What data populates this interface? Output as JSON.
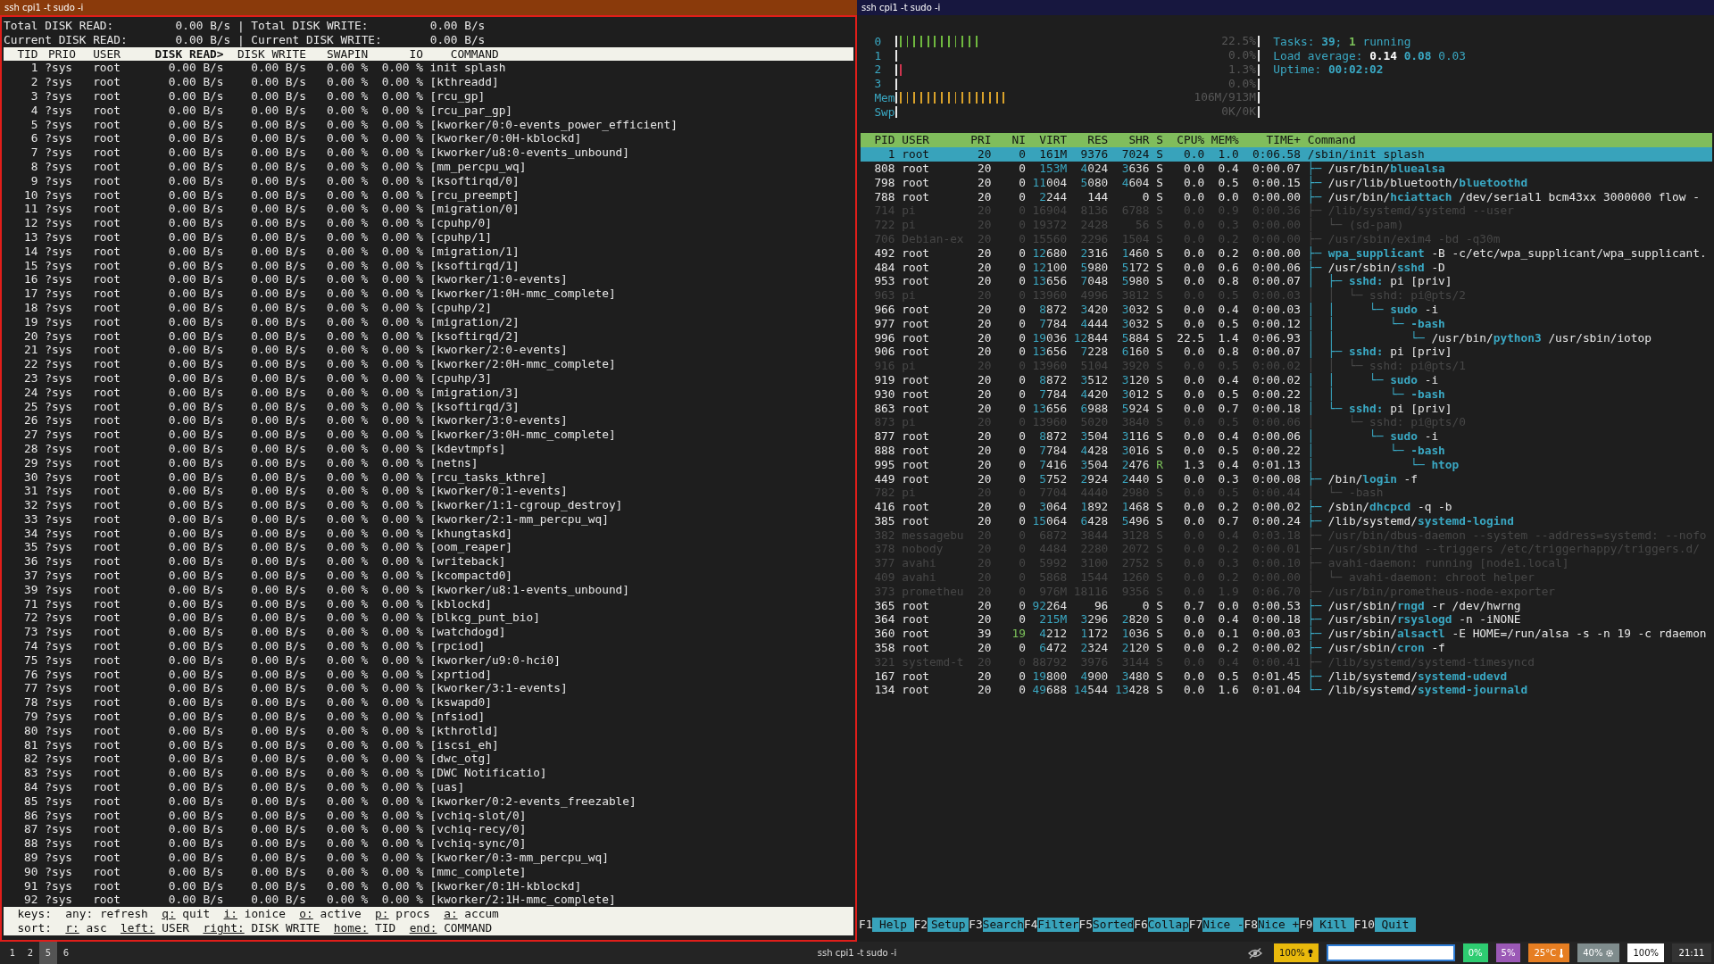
{
  "left_window": {
    "title": "ssh cpi1 -t sudo -i",
    "active": true,
    "summary": [
      "Total DISK READ:         0.00 B/s | Total DISK WRITE:         0.00 B/s",
      "Current DISK READ:       0.00 B/s | Current DISK WRITE:       0.00 B/s"
    ],
    "columns": [
      {
        "label": "TID",
        "sorted": false
      },
      {
        "label": "PRIO",
        "sorted": false
      },
      {
        "label": "USER",
        "sorted": false
      },
      {
        "label": "DISK READ>",
        "sorted": true
      },
      {
        "label": "DISK WRITE",
        "sorted": false
      },
      {
        "label": "SWAPIN",
        "sorted": false
      },
      {
        "label": "IO",
        "sorted": false
      },
      {
        "label": "COMMAND",
        "sorted": false
      }
    ],
    "rows": [
      [
        "1",
        "?sys",
        "root",
        "0.00 B/s",
        "0.00 B/s",
        "0.00 %",
        "0.00 %",
        "init splash"
      ],
      [
        "2",
        "?sys",
        "root",
        "0.00 B/s",
        "0.00 B/s",
        "0.00 %",
        "0.00 %",
        "[kthreadd]"
      ],
      [
        "3",
        "?sys",
        "root",
        "0.00 B/s",
        "0.00 B/s",
        "0.00 %",
        "0.00 %",
        "[rcu_gp]"
      ],
      [
        "4",
        "?sys",
        "root",
        "0.00 B/s",
        "0.00 B/s",
        "0.00 %",
        "0.00 %",
        "[rcu_par_gp]"
      ],
      [
        "5",
        "?sys",
        "root",
        "0.00 B/s",
        "0.00 B/s",
        "0.00 %",
        "0.00 %",
        "[kworker/0:0-events_power_efficient]"
      ],
      [
        "6",
        "?sys",
        "root",
        "0.00 B/s",
        "0.00 B/s",
        "0.00 %",
        "0.00 %",
        "[kworker/0:0H-kblockd]"
      ],
      [
        "7",
        "?sys",
        "root",
        "0.00 B/s",
        "0.00 B/s",
        "0.00 %",
        "0.00 %",
        "[kworker/u8:0-events_unbound]"
      ],
      [
        "8",
        "?sys",
        "root",
        "0.00 B/s",
        "0.00 B/s",
        "0.00 %",
        "0.00 %",
        "[mm_percpu_wq]"
      ],
      [
        "9",
        "?sys",
        "root",
        "0.00 B/s",
        "0.00 B/s",
        "0.00 %",
        "0.00 %",
        "[ksoftirqd/0]"
      ],
      [
        "10",
        "?sys",
        "root",
        "0.00 B/s",
        "0.00 B/s",
        "0.00 %",
        "0.00 %",
        "[rcu_preempt]"
      ],
      [
        "11",
        "?sys",
        "root",
        "0.00 B/s",
        "0.00 B/s",
        "0.00 %",
        "0.00 %",
        "[migration/0]"
      ],
      [
        "12",
        "?sys",
        "root",
        "0.00 B/s",
        "0.00 B/s",
        "0.00 %",
        "0.00 %",
        "[cpuhp/0]"
      ],
      [
        "13",
        "?sys",
        "root",
        "0.00 B/s",
        "0.00 B/s",
        "0.00 %",
        "0.00 %",
        "[cpuhp/1]"
      ],
      [
        "14",
        "?sys",
        "root",
        "0.00 B/s",
        "0.00 B/s",
        "0.00 %",
        "0.00 %",
        "[migration/1]"
      ],
      [
        "15",
        "?sys",
        "root",
        "0.00 B/s",
        "0.00 B/s",
        "0.00 %",
        "0.00 %",
        "[ksoftirqd/1]"
      ],
      [
        "16",
        "?sys",
        "root",
        "0.00 B/s",
        "0.00 B/s",
        "0.00 %",
        "0.00 %",
        "[kworker/1:0-events]"
      ],
      [
        "17",
        "?sys",
        "root",
        "0.00 B/s",
        "0.00 B/s",
        "0.00 %",
        "0.00 %",
        "[kworker/1:0H-mmc_complete]"
      ],
      [
        "18",
        "?sys",
        "root",
        "0.00 B/s",
        "0.00 B/s",
        "0.00 %",
        "0.00 %",
        "[cpuhp/2]"
      ],
      [
        "19",
        "?sys",
        "root",
        "0.00 B/s",
        "0.00 B/s",
        "0.00 %",
        "0.00 %",
        "[migration/2]"
      ],
      [
        "20",
        "?sys",
        "root",
        "0.00 B/s",
        "0.00 B/s",
        "0.00 %",
        "0.00 %",
        "[ksoftirqd/2]"
      ],
      [
        "21",
        "?sys",
        "root",
        "0.00 B/s",
        "0.00 B/s",
        "0.00 %",
        "0.00 %",
        "[kworker/2:0-events]"
      ],
      [
        "22",
        "?sys",
        "root",
        "0.00 B/s",
        "0.00 B/s",
        "0.00 %",
        "0.00 %",
        "[kworker/2:0H-mmc_complete]"
      ],
      [
        "23",
        "?sys",
        "root",
        "0.00 B/s",
        "0.00 B/s",
        "0.00 %",
        "0.00 %",
        "[cpuhp/3]"
      ],
      [
        "24",
        "?sys",
        "root",
        "0.00 B/s",
        "0.00 B/s",
        "0.00 %",
        "0.00 %",
        "[migration/3]"
      ],
      [
        "25",
        "?sys",
        "root",
        "0.00 B/s",
        "0.00 B/s",
        "0.00 %",
        "0.00 %",
        "[ksoftirqd/3]"
      ],
      [
        "26",
        "?sys",
        "root",
        "0.00 B/s",
        "0.00 B/s",
        "0.00 %",
        "0.00 %",
        "[kworker/3:0-events]"
      ],
      [
        "27",
        "?sys",
        "root",
        "0.00 B/s",
        "0.00 B/s",
        "0.00 %",
        "0.00 %",
        "[kworker/3:0H-mmc_complete]"
      ],
      [
        "28",
        "?sys",
        "root",
        "0.00 B/s",
        "0.00 B/s",
        "0.00 %",
        "0.00 %",
        "[kdevtmpfs]"
      ],
      [
        "29",
        "?sys",
        "root",
        "0.00 B/s",
        "0.00 B/s",
        "0.00 %",
        "0.00 %",
        "[netns]"
      ],
      [
        "30",
        "?sys",
        "root",
        "0.00 B/s",
        "0.00 B/s",
        "0.00 %",
        "0.00 %",
        "[rcu_tasks_kthre]"
      ],
      [
        "31",
        "?sys",
        "root",
        "0.00 B/s",
        "0.00 B/s",
        "0.00 %",
        "0.00 %",
        "[kworker/0:1-events]"
      ],
      [
        "32",
        "?sys",
        "root",
        "0.00 B/s",
        "0.00 B/s",
        "0.00 %",
        "0.00 %",
        "[kworker/1:1-cgroup_destroy]"
      ],
      [
        "33",
        "?sys",
        "root",
        "0.00 B/s",
        "0.00 B/s",
        "0.00 %",
        "0.00 %",
        "[kworker/2:1-mm_percpu_wq]"
      ],
      [
        "34",
        "?sys",
        "root",
        "0.00 B/s",
        "0.00 B/s",
        "0.00 %",
        "0.00 %",
        "[khungtaskd]"
      ],
      [
        "35",
        "?sys",
        "root",
        "0.00 B/s",
        "0.00 B/s",
        "0.00 %",
        "0.00 %",
        "[oom_reaper]"
      ],
      [
        "36",
        "?sys",
        "root",
        "0.00 B/s",
        "0.00 B/s",
        "0.00 %",
        "0.00 %",
        "[writeback]"
      ],
      [
        "37",
        "?sys",
        "root",
        "0.00 B/s",
        "0.00 B/s",
        "0.00 %",
        "0.00 %",
        "[kcompactd0]"
      ],
      [
        "39",
        "?sys",
        "root",
        "0.00 B/s",
        "0.00 B/s",
        "0.00 %",
        "0.00 %",
        "[kworker/u8:1-events_unbound]"
      ],
      [
        "71",
        "?sys",
        "root",
        "0.00 B/s",
        "0.00 B/s",
        "0.00 %",
        "0.00 %",
        "[kblockd]"
      ],
      [
        "72",
        "?sys",
        "root",
        "0.00 B/s",
        "0.00 B/s",
        "0.00 %",
        "0.00 %",
        "[blkcg_punt_bio]"
      ],
      [
        "73",
        "?sys",
        "root",
        "0.00 B/s",
        "0.00 B/s",
        "0.00 %",
        "0.00 %",
        "[watchdogd]"
      ],
      [
        "74",
        "?sys",
        "root",
        "0.00 B/s",
        "0.00 B/s",
        "0.00 %",
        "0.00 %",
        "[rpciod]"
      ],
      [
        "75",
        "?sys",
        "root",
        "0.00 B/s",
        "0.00 B/s",
        "0.00 %",
        "0.00 %",
        "[kworker/u9:0-hci0]"
      ],
      [
        "76",
        "?sys",
        "root",
        "0.00 B/s",
        "0.00 B/s",
        "0.00 %",
        "0.00 %",
        "[xprtiod]"
      ],
      [
        "77",
        "?sys",
        "root",
        "0.00 B/s",
        "0.00 B/s",
        "0.00 %",
        "0.00 %",
        "[kworker/3:1-events]"
      ],
      [
        "78",
        "?sys",
        "root",
        "0.00 B/s",
        "0.00 B/s",
        "0.00 %",
        "0.00 %",
        "[kswapd0]"
      ],
      [
        "79",
        "?sys",
        "root",
        "0.00 B/s",
        "0.00 B/s",
        "0.00 %",
        "0.00 %",
        "[nfsiod]"
      ],
      [
        "80",
        "?sys",
        "root",
        "0.00 B/s",
        "0.00 B/s",
        "0.00 %",
        "0.00 %",
        "[kthrotld]"
      ],
      [
        "81",
        "?sys",
        "root",
        "0.00 B/s",
        "0.00 B/s",
        "0.00 %",
        "0.00 %",
        "[iscsi_eh]"
      ],
      [
        "82",
        "?sys",
        "root",
        "0.00 B/s",
        "0.00 B/s",
        "0.00 %",
        "0.00 %",
        "[dwc_otg]"
      ],
      [
        "83",
        "?sys",
        "root",
        "0.00 B/s",
        "0.00 B/s",
        "0.00 %",
        "0.00 %",
        "[DWC Notificatio]"
      ],
      [
        "84",
        "?sys",
        "root",
        "0.00 B/s",
        "0.00 B/s",
        "0.00 %",
        "0.00 %",
        "[uas]"
      ],
      [
        "85",
        "?sys",
        "root",
        "0.00 B/s",
        "0.00 B/s",
        "0.00 %",
        "0.00 %",
        "[kworker/0:2-events_freezable]"
      ],
      [
        "86",
        "?sys",
        "root",
        "0.00 B/s",
        "0.00 B/s",
        "0.00 %",
        "0.00 %",
        "[vchiq-slot/0]"
      ],
      [
        "87",
        "?sys",
        "root",
        "0.00 B/s",
        "0.00 B/s",
        "0.00 %",
        "0.00 %",
        "[vchiq-recy/0]"
      ],
      [
        "88",
        "?sys",
        "root",
        "0.00 B/s",
        "0.00 B/s",
        "0.00 %",
        "0.00 %",
        "[vchiq-sync/0]"
      ],
      [
        "89",
        "?sys",
        "root",
        "0.00 B/s",
        "0.00 B/s",
        "0.00 %",
        "0.00 %",
        "[kworker/0:3-mm_percpu_wq]"
      ],
      [
        "90",
        "?sys",
        "root",
        "0.00 B/s",
        "0.00 B/s",
        "0.00 %",
        "0.00 %",
        "[mmc_complete]"
      ],
      [
        "91",
        "?sys",
        "root",
        "0.00 B/s",
        "0.00 B/s",
        "0.00 %",
        "0.00 %",
        "[kworker/0:1H-kblockd]"
      ],
      [
        "92",
        "?sys",
        "root",
        "0.00 B/s",
        "0.00 B/s",
        "0.00 %",
        "0.00 %",
        "[kworker/2:1H-mmc_complete]"
      ]
    ],
    "key_lines": [
      {
        "prefix": "keys:",
        "items": [
          {
            "key": "any:",
            "action": "refresh",
            "underlined": false
          },
          {
            "key": "q:",
            "action": "quit",
            "underlined": true
          },
          {
            "key": "i:",
            "action": "ionice",
            "underlined": true
          },
          {
            "key": "o:",
            "action": "active",
            "underlined": true
          },
          {
            "key": "p:",
            "action": "procs",
            "underlined": true
          },
          {
            "key": "a:",
            "action": "accum",
            "underlined": true
          }
        ]
      },
      {
        "prefix": "sort:",
        "items": [
          {
            "key": "r:",
            "action": "asc",
            "underlined": true
          },
          {
            "key": "left:",
            "action": "USER",
            "underlined": true
          },
          {
            "key": "right:",
            "action": "DISK WRITE",
            "underlined": true
          },
          {
            "key": "home:",
            "action": "TID",
            "underlined": true
          },
          {
            "key": "end:",
            "action": "COMMAND",
            "underlined": true
          }
        ]
      }
    ]
  },
  "right_window": {
    "title": "ssh cpi1 -t sudo -i",
    "active": false,
    "meters": [
      {
        "label": "0",
        "reading": "22.5%",
        "level": 0.227,
        "color": "#6fb83f"
      },
      {
        "label": "1",
        "reading": "0.0%"
      },
      {
        "label": "2",
        "reading": "1.3%",
        "level": 0.019,
        "color": "#d0354f"
      },
      {
        "label": "3",
        "reading": "0.0%"
      },
      {
        "label": "Mem",
        "reading": "106M/913M",
        "level": 0.302,
        "color": "#d8a12a"
      },
      {
        "label": "Swp",
        "reading": "0K/0K"
      }
    ],
    "tasks": {
      "label": "Tasks:",
      "count": "39",
      "separator": ";",
      "running": "1",
      "running_label": "running"
    },
    "load": {
      "label": "Load average:",
      "values": [
        "0.14",
        "0.08",
        "0.03"
      ]
    },
    "uptime": {
      "label": "Uptime:",
      "value": "00:02:02"
    },
    "columns": [
      "PID",
      "USER",
      "PRI",
      "NI",
      "VIRT",
      "RES",
      "SHR",
      "S",
      "CPU%",
      "MEM%",
      "TIME+",
      "Command"
    ],
    "rows": [
      {
        "pid": "1",
        "user": "root",
        "pri": "20",
        "ni": "0",
        "virt": "161M",
        "res": "9376",
        "shr": "7024",
        "s": "S",
        "cpu": "0.0",
        "mem": "1.0",
        "time": "0:06.58",
        "command": "/sbin/init splash",
        "selected": true,
        "dimmed": false,
        "running": false,
        "niced": false
      },
      {
        "pid": "808",
        "user": "root",
        "pri": "20",
        "ni": "0",
        "virt": "153M",
        "res": "4024",
        "shr": "3636",
        "s": "S",
        "cpu": "0.0",
        "mem": "0.4",
        "time": "0:00.07",
        "tree": "├─ ",
        "command": "/usr/bin/**bluealsa**",
        "selected": false,
        "dimmed": false,
        "running": false,
        "niced": false
      },
      {
        "pid": "798",
        "user": "root",
        "pri": "20",
        "ni": "0",
        "virt": "11004",
        "res": "5080",
        "shr": "4604",
        "s": "S",
        "cpu": "0.0",
        "mem": "0.5",
        "time": "0:00.15",
        "tree": "├─ ",
        "command": "/usr/lib/bluetooth/**bluetoothd**",
        "selected": false,
        "dimmed": false,
        "running": false,
        "niced": false
      },
      {
        "pid": "788",
        "user": "root",
        "pri": "20",
        "ni": "0",
        "virt": "2244",
        "res": "144",
        "shr": "0",
        "s": "S",
        "cpu": "0.0",
        "mem": "0.0",
        "time": "0:00.00",
        "tree": "├─ ",
        "command": "/usr/bin/**hciattach** /dev/serial1 bcm43xx 3000000 flow -",
        "selected": false,
        "dimmed": false,
        "running": false,
        "niced": false
      },
      {
        "pid": "714",
        "user": "pi",
        "pri": "20",
        "ni": "0",
        "virt": "16904",
        "res": "8136",
        "shr": "6788",
        "s": "S",
        "cpu": "0.0",
        "mem": "0.9",
        "time": "0:00.36",
        "tree": "├─ ",
        "command": "/lib/systemd/systemd --user",
        "selected": false,
        "dimmed": true,
        "running": false,
        "niced": false
      },
      {
        "pid": "722",
        "user": "pi",
        "pri": "20",
        "ni": "0",
        "virt": "19372",
        "res": "2428",
        "shr": "56",
        "s": "S",
        "cpu": "0.0",
        "mem": "0.3",
        "time": "0:00.00",
        "tree": "│  └─ ",
        "command": "(sd-pam)",
        "selected": false,
        "dimmed": true,
        "running": false,
        "niced": false
      },
      {
        "pid": "706",
        "user": "Debian-ex",
        "pri": "20",
        "ni": "0",
        "virt": "15560",
        "res": "2296",
        "shr": "1504",
        "s": "S",
        "cpu": "0.0",
        "mem": "0.2",
        "time": "0:00.00",
        "tree": "├─ ",
        "command": "/usr/sbin/exim4 -bd -q30m",
        "selected": false,
        "dimmed": true,
        "running": false,
        "niced": false
      },
      {
        "pid": "492",
        "user": "root",
        "pri": "20",
        "ni": "0",
        "virt": "12680",
        "res": "2316",
        "shr": "1460",
        "s": "S",
        "cpu": "0.0",
        "mem": "0.2",
        "time": "0:00.00",
        "tree": "├─ ",
        "command": "**wpa_supplicant** -B -c/etc/wpa_supplicant/wpa_supplicant.",
        "selected": false,
        "dimmed": false,
        "running": false,
        "niced": false
      },
      {
        "pid": "484",
        "user": "root",
        "pri": "20",
        "ni": "0",
        "virt": "12100",
        "res": "5980",
        "shr": "5172",
        "s": "S",
        "cpu": "0.0",
        "mem": "0.6",
        "time": "0:00.06",
        "tree": "├─ ",
        "command": "/usr/sbin/**sshd** -D",
        "selected": false,
        "dimmed": false,
        "running": false,
        "niced": false
      },
      {
        "pid": "953",
        "user": "root",
        "pri": "20",
        "ni": "0",
        "virt": "13656",
        "res": "7048",
        "shr": "5980",
        "s": "S",
        "cpu": "0.0",
        "mem": "0.8",
        "time": "0:00.07",
        "tree": "│  ├─ ",
        "command": "**sshd:** pi [priv]",
        "selected": false,
        "dimmed": false,
        "running": false,
        "niced": false
      },
      {
        "pid": "963",
        "user": "pi",
        "pri": "20",
        "ni": "0",
        "virt": "13960",
        "res": "4996",
        "shr": "3812",
        "s": "S",
        "cpu": "0.0",
        "mem": "0.5",
        "time": "0:00.03",
        "tree": "│  │  └─ ",
        "command": "sshd: pi@pts/2",
        "selected": false,
        "dimmed": true,
        "running": false,
        "niced": false
      },
      {
        "pid": "966",
        "user": "root",
        "pri": "20",
        "ni": "0",
        "virt": "8872",
        "res": "3420",
        "shr": "3032",
        "s": "S",
        "cpu": "0.0",
        "mem": "0.4",
        "time": "0:00.03",
        "tree": "│  │     └─ ",
        "command": "**sudo** -i",
        "selected": false,
        "dimmed": false,
        "running": false,
        "niced": false
      },
      {
        "pid": "977",
        "user": "root",
        "pri": "20",
        "ni": "0",
        "virt": "7784",
        "res": "4444",
        "shr": "3032",
        "s": "S",
        "cpu": "0.0",
        "mem": "0.5",
        "time": "0:00.12",
        "tree": "│  │        └─ ",
        "command": "**-bash**",
        "selected": false,
        "dimmed": false,
        "running": false,
        "niced": false
      },
      {
        "pid": "996",
        "user": "root",
        "pri": "20",
        "ni": "0",
        "virt": "19036",
        "res": "12844",
        "shr": "5884",
        "s": "S",
        "cpu": "22.5",
        "mem": "1.4",
        "time": "0:06.93",
        "tree": "│  │           └─ ",
        "command": "/usr/bin/**python3** /usr/sbin/iotop",
        "selected": false,
        "dimmed": false,
        "running": false,
        "niced": false
      },
      {
        "pid": "906",
        "user": "root",
        "pri": "20",
        "ni": "0",
        "virt": "13656",
        "res": "7228",
        "shr": "6160",
        "s": "S",
        "cpu": "0.0",
        "mem": "0.8",
        "time": "0:00.07",
        "tree": "│  ├─ ",
        "command": "**sshd:** pi [priv]",
        "selected": false,
        "dimmed": false,
        "running": false,
        "niced": false
      },
      {
        "pid": "916",
        "user": "pi",
        "pri": "20",
        "ni": "0",
        "virt": "13960",
        "res": "5104",
        "shr": "3920",
        "s": "S",
        "cpu": "0.0",
        "mem": "0.5",
        "time": "0:00.02",
        "tree": "│  │  └─ ",
        "command": "sshd: pi@pts/1",
        "selected": false,
        "dimmed": true,
        "running": false,
        "niced": false
      },
      {
        "pid": "919",
        "user": "root",
        "pri": "20",
        "ni": "0",
        "virt": "8872",
        "res": "3512",
        "shr": "3120",
        "s": "S",
        "cpu": "0.0",
        "mem": "0.4",
        "time": "0:00.02",
        "tree": "│  │     └─ ",
        "command": "**sudo** -i",
        "selected": false,
        "dimmed": false,
        "running": false,
        "niced": false
      },
      {
        "pid": "930",
        "user": "root",
        "pri": "20",
        "ni": "0",
        "virt": "7784",
        "res": "4420",
        "shr": "3012",
        "s": "S",
        "cpu": "0.0",
        "mem": "0.5",
        "time": "0:00.22",
        "tree": "│  │        └─ ",
        "command": "**-bash**",
        "selected": false,
        "dimmed": false,
        "running": false,
        "niced": false
      },
      {
        "pid": "863",
        "user": "root",
        "pri": "20",
        "ni": "0",
        "virt": "13656",
        "res": "6988",
        "shr": "5924",
        "s": "S",
        "cpu": "0.0",
        "mem": "0.7",
        "time": "0:00.18",
        "tree": "│  └─ ",
        "command": "**sshd:** pi [priv]",
        "selected": false,
        "dimmed": false,
        "running": false,
        "niced": false
      },
      {
        "pid": "873",
        "user": "pi",
        "pri": "20",
        "ni": "0",
        "virt": "13960",
        "res": "5020",
        "shr": "3840",
        "s": "S",
        "cpu": "0.0",
        "mem": "0.5",
        "time": "0:00.06",
        "tree": "│     └─ ",
        "command": "sshd: pi@pts/0",
        "selected": false,
        "dimmed": true,
        "running": false,
        "niced": false
      },
      {
        "pid": "877",
        "user": "root",
        "pri": "20",
        "ni": "0",
        "virt": "8872",
        "res": "3504",
        "shr": "3116",
        "s": "S",
        "cpu": "0.0",
        "mem": "0.4",
        "time": "0:00.06",
        "tree": "│        └─ ",
        "command": "**sudo** -i",
        "selected": false,
        "dimmed": false,
        "running": false,
        "niced": false
      },
      {
        "pid": "888",
        "user": "root",
        "pri": "20",
        "ni": "0",
        "virt": "7784",
        "res": "4428",
        "shr": "3016",
        "s": "S",
        "cpu": "0.0",
        "mem": "0.5",
        "time": "0:00.22",
        "tree": "│           └─ ",
        "command": "**-bash**",
        "selected": false,
        "dimmed": false,
        "running": false,
        "niced": false
      },
      {
        "pid": "995",
        "user": "root",
        "pri": "20",
        "ni": "0",
        "virt": "7416",
        "res": "3504",
        "shr": "2476",
        "s": "R",
        "cpu": "1.3",
        "mem": "0.4",
        "time": "0:01.13",
        "tree": "│              └─ ",
        "command": "**htop**",
        "selected": false,
        "dimmed": false,
        "running": true,
        "niced": false
      },
      {
        "pid": "449",
        "user": "root",
        "pri": "20",
        "ni": "0",
        "virt": "5752",
        "res": "2924",
        "shr": "2440",
        "s": "S",
        "cpu": "0.0",
        "mem": "0.3",
        "time": "0:00.08",
        "tree": "├─ ",
        "command": "/bin/**login** -f",
        "selected": false,
        "dimmed": false,
        "running": false,
        "niced": false
      },
      {
        "pid": "782",
        "user": "pi",
        "pri": "20",
        "ni": "0",
        "virt": "7704",
        "res": "4440",
        "shr": "2980",
        "s": "S",
        "cpu": "0.0",
        "mem": "0.5",
        "time": "0:00.44",
        "tree": "│  └─ ",
        "command": "-bash",
        "selected": false,
        "dimmed": true,
        "running": false,
        "niced": false
      },
      {
        "pid": "416",
        "user": "root",
        "pri": "20",
        "ni": "0",
        "virt": "3064",
        "res": "1892",
        "shr": "1468",
        "s": "S",
        "cpu": "0.0",
        "mem": "0.2",
        "time": "0:00.02",
        "tree": "├─ ",
        "command": "/sbin/**dhcpcd** -q -b",
        "selected": false,
        "dimmed": false,
        "running": false,
        "niced": false
      },
      {
        "pid": "385",
        "user": "root",
        "pri": "20",
        "ni": "0",
        "virt": "15064",
        "res": "6428",
        "shr": "5496",
        "s": "S",
        "cpu": "0.0",
        "mem": "0.7",
        "time": "0:00.24",
        "tree": "├─ ",
        "command": "/lib/systemd/**systemd-logind**",
        "selected": false,
        "dimmed": false,
        "running": false,
        "niced": false
      },
      {
        "pid": "382",
        "user": "messagebu",
        "pri": "20",
        "ni": "0",
        "virt": "6872",
        "res": "3844",
        "shr": "3128",
        "s": "S",
        "cpu": "0.0",
        "mem": "0.4",
        "time": "0:03.18",
        "tree": "├─ ",
        "command": "/usr/bin/dbus-daemon --system --address=systemd: --nofo",
        "selected": false,
        "dimmed": true,
        "running": false,
        "niced": false
      },
      {
        "pid": "378",
        "user": "nobody",
        "pri": "20",
        "ni": "0",
        "virt": "4484",
        "res": "2280",
        "shr": "2072",
        "s": "S",
        "cpu": "0.0",
        "mem": "0.2",
        "time": "0:00.01",
        "tree": "├─ ",
        "command": "/usr/sbin/thd --triggers /etc/triggerhappy/triggers.d/",
        "selected": false,
        "dimmed": true,
        "running": false,
        "niced": false
      },
      {
        "pid": "377",
        "user": "avahi",
        "pri": "20",
        "ni": "0",
        "virt": "5992",
        "res": "3100",
        "shr": "2752",
        "s": "S",
        "cpu": "0.0",
        "mem": "0.3",
        "time": "0:00.10",
        "tree": "├─ ",
        "command": "avahi-daemon: running [node1.local]",
        "selected": false,
        "dimmed": true,
        "running": false,
        "niced": false
      },
      {
        "pid": "409",
        "user": "avahi",
        "pri": "20",
        "ni": "0",
        "virt": "5868",
        "res": "1544",
        "shr": "1260",
        "s": "S",
        "cpu": "0.0",
        "mem": "0.2",
        "time": "0:00.00",
        "tree": "│  └─ ",
        "command": "avahi-daemon: chroot helper",
        "selected": false,
        "dimmed": true,
        "running": false,
        "niced": false
      },
      {
        "pid": "373",
        "user": "prometheu",
        "pri": "20",
        "ni": "0",
        "virt": "976M",
        "res": "18116",
        "shr": "9356",
        "s": "S",
        "cpu": "0.0",
        "mem": "1.9",
        "time": "0:06.70",
        "tree": "├─ ",
        "command": "/usr/bin/prometheus-node-exporter",
        "selected": false,
        "dimmed": true,
        "running": false,
        "niced": false
      },
      {
        "pid": "365",
        "user": "root",
        "pri": "20",
        "ni": "0",
        "virt": "92264",
        "res": "96",
        "shr": "0",
        "s": "S",
        "cpu": "0.7",
        "mem": "0.0",
        "time": "0:00.53",
        "tree": "├─ ",
        "command": "/usr/sbin/**rngd** -r /dev/hwrng",
        "selected": false,
        "dimmed": false,
        "running": false,
        "niced": false
      },
      {
        "pid": "364",
        "user": "root",
        "pri": "20",
        "ni": "0",
        "virt": "215M",
        "res": "3296",
        "shr": "2820",
        "s": "S",
        "cpu": "0.0",
        "mem": "0.4",
        "time": "0:00.18",
        "tree": "├─ ",
        "command": "/usr/sbin/**rsyslogd** -n -iNONE",
        "selected": false,
        "dimmed": false,
        "running": false,
        "niced": false
      },
      {
        "pid": "360",
        "user": "root",
        "pri": "39",
        "ni": "19",
        "virt": "4212",
        "res": "1172",
        "shr": "1036",
        "s": "S",
        "cpu": "0.0",
        "mem": "0.1",
        "time": "0:00.03",
        "tree": "├─ ",
        "command": "/usr/sbin/**alsactl** -E HOME=/run/alsa -s -n 19 -c rdaemon",
        "selected": false,
        "dimmed": false,
        "running": false,
        "niced": true
      },
      {
        "pid": "358",
        "user": "root",
        "pri": "20",
        "ni": "0",
        "virt": "6472",
        "res": "2324",
        "shr": "2120",
        "s": "S",
        "cpu": "0.0",
        "mem": "0.2",
        "time": "0:00.02",
        "tree": "├─ ",
        "command": "/usr/sbin/**cron** -f",
        "selected": false,
        "dimmed": false,
        "running": false,
        "niced": false
      },
      {
        "pid": "321",
        "user": "systemd-t",
        "pri": "20",
        "ni": "0",
        "virt": "88792",
        "res": "3976",
        "shr": "3144",
        "s": "S",
        "cpu": "0.0",
        "mem": "0.4",
        "time": "0:00.41",
        "tree": "├─ ",
        "command": "/lib/systemd/systemd-timesyncd",
        "selected": false,
        "dimmed": true,
        "running": false,
        "niced": false
      },
      {
        "pid": "167",
        "user": "root",
        "pri": "20",
        "ni": "0",
        "virt": "19800",
        "res": "4900",
        "shr": "3480",
        "s": "S",
        "cpu": "0.0",
        "mem": "0.5",
        "time": "0:01.45",
        "tree": "├─ ",
        "command": "/lib/systemd/**systemd-udevd**",
        "selected": false,
        "dimmed": false,
        "running": false,
        "niced": false
      },
      {
        "pid": "134",
        "user": "root",
        "pri": "20",
        "ni": "0",
        "virt": "49688",
        "res": "14544",
        "shr": "13428",
        "s": "S",
        "cpu": "0.0",
        "mem": "1.6",
        "time": "0:01.04",
        "tree": "└─ ",
        "command": "/lib/systemd/**systemd-journald**",
        "selected": false,
        "dimmed": false,
        "running": false,
        "niced": false
      }
    ],
    "function_keys": [
      {
        "key": "F1",
        "label": "Help"
      },
      {
        "key": "F2",
        "label": "Setup"
      },
      {
        "key": "F3",
        "label": "Search"
      },
      {
        "key": "F4",
        "label": "Filter"
      },
      {
        "key": "F5",
        "label": "Sorted"
      },
      {
        "key": "F6",
        "label": "Collap"
      },
      {
        "key": "F7",
        "label": "Nice -"
      },
      {
        "key": "F8",
        "label": "Nice +"
      },
      {
        "key": "F9",
        "label": "Kill"
      },
      {
        "key": "F10",
        "label": "Quit"
      }
    ]
  },
  "taskbar": {
    "workspaces": [
      {
        "label": "1",
        "selected": false
      },
      {
        "label": "2",
        "selected": false
      },
      {
        "label": "5",
        "selected": true
      },
      {
        "label": "6",
        "selected": false
      }
    ],
    "title": "ssh cpi1 -t sudo -i",
    "indicators": [
      {
        "kind": "hidden"
      },
      {
        "kind": "brightness",
        "text": "100%",
        "color": "#e9b90c"
      },
      {
        "kind": "field"
      },
      {
        "kind": "plain",
        "text": "0%",
        "color": "#2ecc71"
      },
      {
        "kind": "plain",
        "text": "5%",
        "color": "#9b59b6"
      },
      {
        "kind": "temperature",
        "text": "25°C",
        "color": "#e67e22"
      },
      {
        "kind": "fan",
        "text": "40%",
        "color": "#7f8c8d"
      },
      {
        "kind": "plain",
        "text": "100%",
        "color": "#ffffff"
      },
      {
        "kind": "clock",
        "text": "21:11",
        "color": "#333333"
      }
    ]
  }
}
